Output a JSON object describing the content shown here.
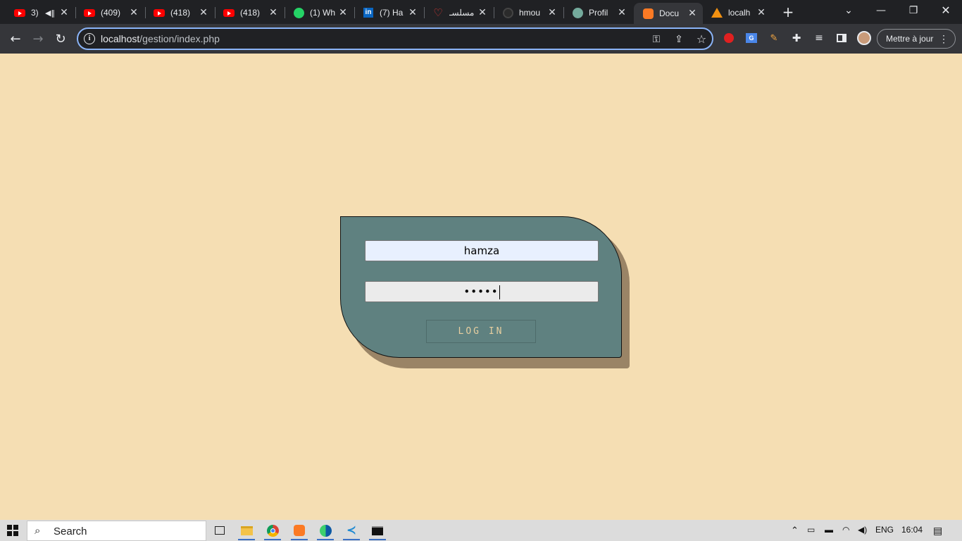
{
  "browser": {
    "tabs": [
      {
        "title": "3)",
        "favicon": "youtube-icon",
        "muted": true
      },
      {
        "title": "(409)",
        "favicon": "youtube-icon"
      },
      {
        "title": "(418)",
        "favicon": "youtube-icon"
      },
      {
        "title": "(418)",
        "favicon": "youtube-icon"
      },
      {
        "title": "(1) Wh",
        "favicon": "whatsapp-icon"
      },
      {
        "title": "(7) Ha",
        "favicon": "linkedin-icon"
      },
      {
        "title": "مسلسـ",
        "favicon": "heart-icon"
      },
      {
        "title": "hmou",
        "favicon": "github-icon"
      },
      {
        "title": "Profil",
        "favicon": "chatgpt-icon"
      },
      {
        "title": "Docu",
        "favicon": "xampp-icon",
        "active": true
      },
      {
        "title": "localh",
        "favicon": "phpmyadmin-icon"
      }
    ],
    "address": {
      "host": "localhost",
      "path": "/gestion/index.php"
    },
    "update_button": "Mettre à jour",
    "update_menu": "⋮"
  },
  "login": {
    "username_value": "hamza",
    "password_mask": "•••••",
    "submit_label": "LOG IN"
  },
  "taskbar": {
    "search_placeholder": "Search",
    "language": "ENG",
    "time": "16:04"
  },
  "colors": {
    "page_bg": "#f5deb3",
    "card_bg": "#5f8180",
    "card_shadow": "#9a8466",
    "button_text": "#e7cfa0"
  }
}
